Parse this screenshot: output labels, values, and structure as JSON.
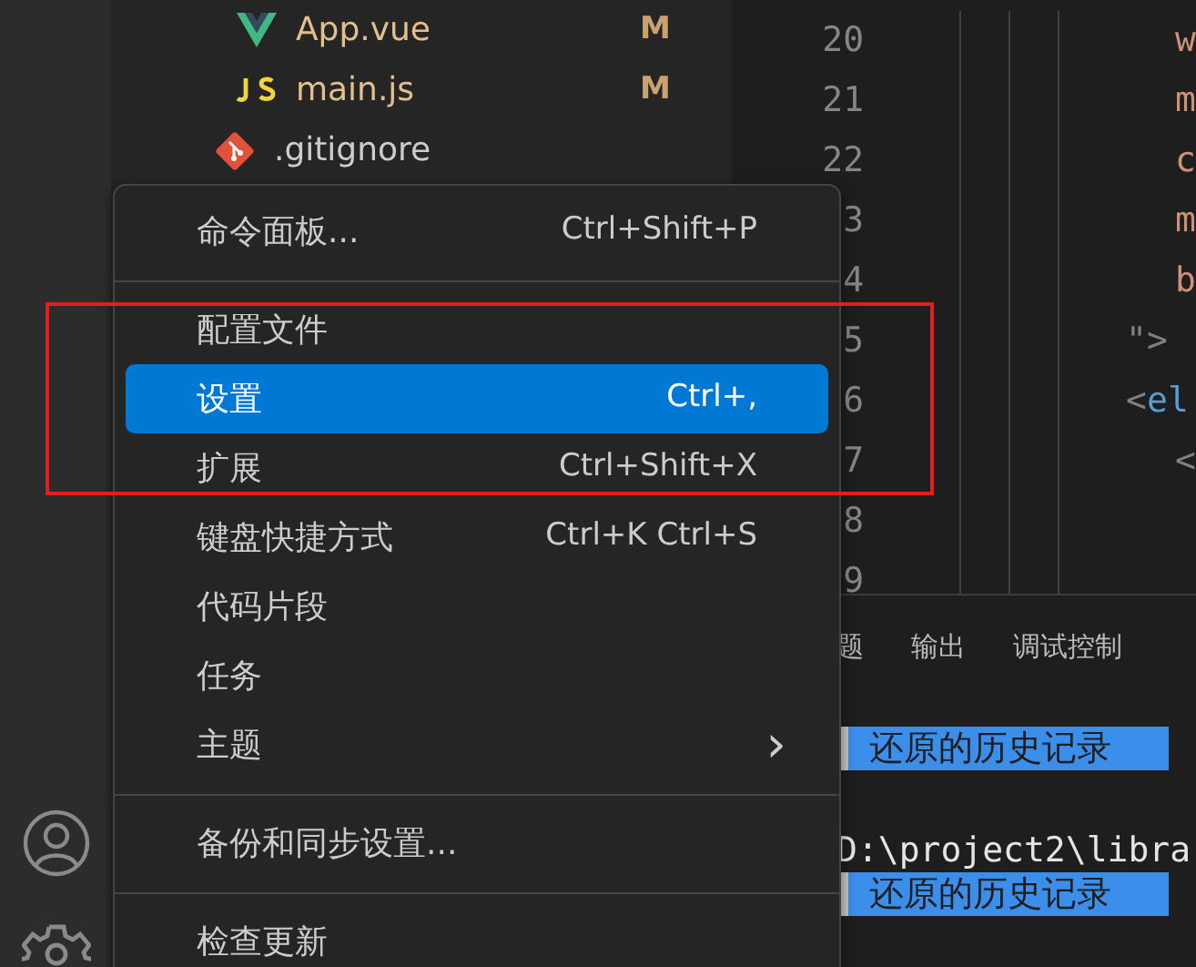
{
  "explorer": {
    "items": [
      {
        "children": [
          {
            "label": "App.vue",
            "kind": "vue",
            "status": "M"
          },
          {
            "label": "main.js",
            "kind": "js",
            "status": "M"
          }
        ]
      },
      {
        "label": ".gitignore",
        "kind": "git"
      }
    ]
  },
  "editor": {
    "line_numbers": [
      "20",
      "21",
      "22",
      "3",
      "4",
      "5",
      "6",
      "7",
      "8",
      "9"
    ],
    "code_lines": [
      {
        "children": [
          {
            "parts": [
              {
                "text": "w",
                "kind": "string"
              }
            ]
          },
          {
            "parts": [
              {
                "text": "m",
                "kind": "string"
              }
            ]
          },
          {
            "parts": [
              {
                "text": "c",
                "kind": "string"
              }
            ]
          },
          {
            "parts": [
              {
                "text": "m",
                "kind": "string"
              }
            ]
          },
          {
            "parts": [
              {
                "text": "b",
                "kind": "string"
              }
            ]
          }
        ]
      },
      {
        "parts": [
          {
            "text": "\">",
            "kind": "punct"
          }
        ]
      },
      {
        "parts": [
          {
            "text": "<",
            "kind": "punct"
          },
          {
            "text": "el",
            "kind": "tag"
          }
        ],
        "children": [
          {
            "parts": [
              {
                "text": "<",
                "kind": "punct"
              }
            ]
          }
        ]
      }
    ]
  },
  "panel": {
    "tabs": [
      {
        "label": "题"
      },
      {
        "label": "输出"
      },
      {
        "label": "调试控制"
      }
    ],
    "terminal_lines": [
      {
        "text": "还原的历史记录",
        "kind": "marker"
      },
      {
        "text": "D:\\project2\\libra",
        "kind": "path"
      },
      {
        "text": "还原的历史记录",
        "kind": "marker"
      }
    ]
  },
  "menu": {
    "items": [
      {
        "kind": "item",
        "label": "命令面板...",
        "shortcut": "Ctrl+Shift+P",
        "selected": false
      },
      {
        "kind": "separator"
      },
      {
        "kind": "item",
        "label": "配置文件",
        "selected": false
      },
      {
        "kind": "item",
        "label": "设置",
        "shortcut": "Ctrl+,",
        "selected": true
      },
      {
        "kind": "item",
        "label": "扩展",
        "shortcut": "Ctrl+Shift+X",
        "selected": false
      },
      {
        "kind": "item",
        "label": "键盘快捷方式",
        "shortcut": "Ctrl+K Ctrl+S",
        "selected": false
      },
      {
        "kind": "item",
        "label": "代码片段",
        "selected": false
      },
      {
        "kind": "item",
        "label": "任务",
        "selected": false
      },
      {
        "kind": "item",
        "label": "主题",
        "submenu": "›",
        "selected": false
      },
      {
        "kind": "separator"
      },
      {
        "kind": "item",
        "label": "备份和同步设置...",
        "selected": false
      },
      {
        "kind": "separator"
      },
      {
        "kind": "item",
        "label": "检查更新",
        "selected": false
      }
    ]
  },
  "highlight_box": true
}
